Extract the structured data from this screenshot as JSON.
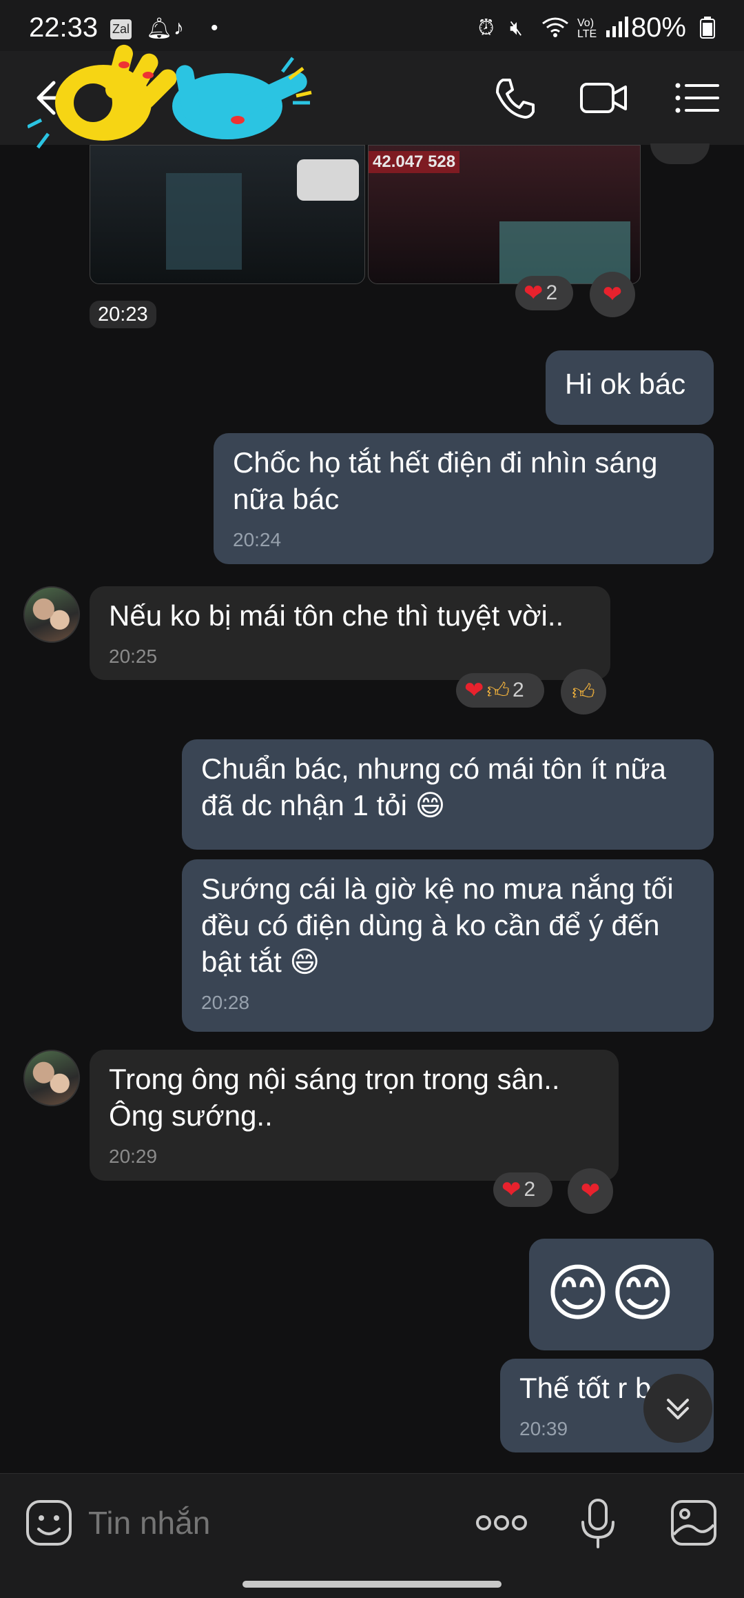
{
  "status_bar": {
    "time": "22:33",
    "battery": "80%",
    "icons": [
      "zalo-icon",
      "bell-icon",
      "tiktok-icon",
      "dot-icon",
      "alarm-icon",
      "mute-icon",
      "wifi-icon",
      "volte-icon",
      "signal-icon",
      "battery-icon"
    ]
  },
  "header": {
    "back_icon": "arrow-left-icon",
    "contact_name_obscured": "",
    "actions": [
      "phone-icon",
      "video-call-icon",
      "menu-list-icon"
    ]
  },
  "media": {
    "photo_text": "42.047 528",
    "time": "20:23",
    "reaction_count": "2"
  },
  "messages": [
    {
      "side": "me",
      "text": "Hi ok bác",
      "time": ""
    },
    {
      "side": "me",
      "text": "Chốc họ tắt hết điện đi nhìn sáng\nnữa bác",
      "time": "20:24"
    },
    {
      "side": "them",
      "text": "Nếu ko bị mái tôn che thì tuyệt vời..",
      "time": "20:25",
      "reaction_count": "2"
    },
    {
      "side": "me",
      "text": "Chuẩn bác, nhưng có mái tôn ít nữa\nđã dc nhận 1 tỏi 😄",
      "time": ""
    },
    {
      "side": "me",
      "text": "Sướng cái là giờ kệ no mưa nắng tối\nđều có điện dùng à ko cần để ý đến\nbật tắt 😄",
      "time": "20:28"
    },
    {
      "side": "them",
      "text": "Trong ông nội sáng trọn trong sân..\nÔng sướng..",
      "time": "20:29",
      "reaction_count": "2"
    },
    {
      "side": "me",
      "text": "😊😊",
      "time": ""
    },
    {
      "side": "me",
      "text": "Thế tốt r b",
      "time": "20:39"
    }
  ],
  "input": {
    "placeholder": "Tin nhắn"
  },
  "colors": {
    "background": "#111112",
    "my_bubble": "#3a4554",
    "their_bubble": "#262626",
    "heart": "#e8222d"
  }
}
